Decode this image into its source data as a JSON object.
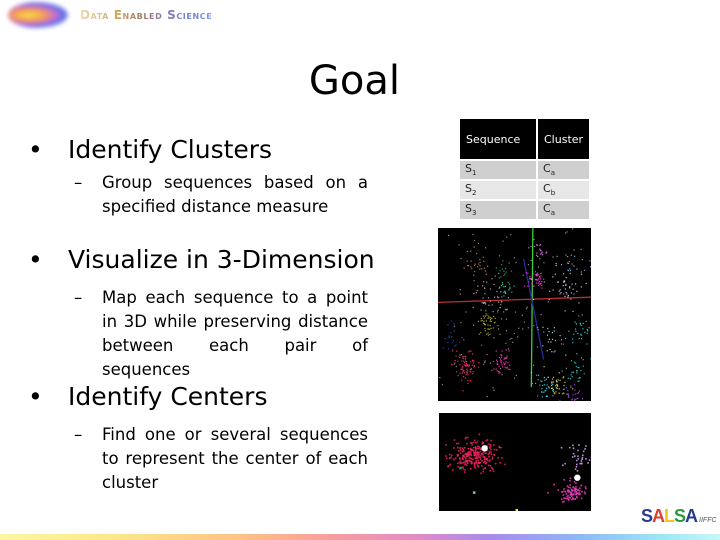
{
  "header": {
    "title": "Data Enabled Science",
    "logo_icon": "gradient-blob-icon"
  },
  "slide": {
    "title": "Goal",
    "bullets": [
      {
        "label": "Identify Clusters",
        "sub": "Group sequences based on a specified distance measure"
      },
      {
        "label": "Visualize in 3-Dimension",
        "sub": "Map each sequence to a point in 3D while preserving distance between each pair of sequences"
      },
      {
        "label": "Identify Centers",
        "sub": "Find one or several sequences to represent the center of each cluster"
      }
    ],
    "bullet_glyph": "•",
    "dash_glyph": "–"
  },
  "table": {
    "headers": [
      "Sequence",
      "Cluster"
    ],
    "rows": [
      {
        "seq": "S",
        "seq_sub": "1",
        "cluster": "C",
        "cluster_sub": "a"
      },
      {
        "seq": "S",
        "seq_sub": "2",
        "cluster": "C",
        "cluster_sub": "b"
      },
      {
        "seq": "S",
        "seq_sub": "3",
        "cluster": "C",
        "cluster_sub": "a"
      }
    ]
  },
  "plots": {
    "clusters_3d": {
      "description": "3D cluster visualization",
      "clusters": [
        {
          "color": "#c8875a",
          "cx": 0.25,
          "cy": 0.2,
          "n": 30,
          "spread": 0.05
        },
        {
          "color": "#d8a6c8",
          "cx": 0.35,
          "cy": 0.38,
          "n": 40,
          "spread": 0.06
        },
        {
          "color": "#2fd49a",
          "cx": 0.43,
          "cy": 0.35,
          "n": 18,
          "spread": 0.03
        },
        {
          "color": "#1fb27a",
          "cx": 0.43,
          "cy": 0.22,
          "n": 14,
          "spread": 0.03
        },
        {
          "color": "#ff2fd8",
          "cx": 0.63,
          "cy": 0.3,
          "n": 40,
          "spread": 0.03
        },
        {
          "color": "#e080e8",
          "cx": 0.67,
          "cy": 0.13,
          "n": 18,
          "spread": 0.03
        },
        {
          "color": "#e0c0f8",
          "cx": 0.83,
          "cy": 0.34,
          "n": 45,
          "spread": 0.06
        },
        {
          "color": "#7fb6d8",
          "cx": 0.85,
          "cy": 0.2,
          "n": 22,
          "spread": 0.05
        },
        {
          "color": "#b8b020",
          "cx": 0.33,
          "cy": 0.55,
          "n": 45,
          "spread": 0.035
        },
        {
          "color": "#2c4cb0",
          "cx": 0.1,
          "cy": 0.64,
          "n": 22,
          "spread": 0.04
        },
        {
          "color": "#ff2f6a",
          "cx": 0.18,
          "cy": 0.79,
          "n": 80,
          "spread": 0.045
        },
        {
          "color": "#ff3fb8",
          "cx": 0.41,
          "cy": 0.76,
          "n": 45,
          "spread": 0.035
        },
        {
          "color": "#ece268",
          "cx": 0.78,
          "cy": 0.9,
          "n": 40,
          "spread": 0.04
        },
        {
          "color": "#2fe0e8",
          "cx": 0.93,
          "cy": 0.6,
          "n": 24,
          "spread": 0.035
        },
        {
          "color": "#3fcfe0",
          "cx": 0.7,
          "cy": 0.92,
          "n": 30,
          "spread": 0.035
        },
        {
          "color": "#30d0d0",
          "cx": 0.9,
          "cy": 0.82,
          "n": 30,
          "spread": 0.04
        },
        {
          "color": "#b050e8",
          "cx": 0.87,
          "cy": 0.97,
          "n": 25,
          "spread": 0.03
        },
        {
          "color": "#a0e0f0",
          "cx": 0.73,
          "cy": 0.63,
          "n": 20,
          "spread": 0.05
        },
        {
          "color": "#ffffff",
          "cx": 0.5,
          "cy": 0.5,
          "n": 140,
          "spread": 0.35
        }
      ],
      "axes": [
        {
          "color": "#b83030",
          "x1": 0.0,
          "y1": 0.43,
          "x2": 1.0,
          "y2": 0.4
        },
        {
          "color": "#3ad03a",
          "x1": 0.62,
          "y1": 0.0,
          "x2": 0.61,
          "y2": 0.92
        },
        {
          "color": "#2a2a9a",
          "x1": 0.56,
          "y1": 0.18,
          "x2": 0.69,
          "y2": 0.76
        }
      ]
    },
    "centers": {
      "description": "Cluster centers visualization",
      "clusters": [
        {
          "color": "#e8205a",
          "cx": 0.22,
          "cy": 0.42,
          "n": 260,
          "spread": 0.08
        },
        {
          "color": "#e838b8",
          "cx": 0.88,
          "cy": 0.8,
          "n": 90,
          "spread": 0.045
        },
        {
          "color": "#c8a0e8",
          "cx": 0.93,
          "cy": 0.45,
          "n": 40,
          "spread": 0.06
        }
      ],
      "centers": [
        {
          "cx": 0.3,
          "cy": 0.36,
          "color": "#ffffff"
        },
        {
          "cx": 0.91,
          "cy": 0.66,
          "color": "#ffffff"
        }
      ],
      "strays": [
        {
          "cx": 0.51,
          "cy": 1.0,
          "color": "#f0e060"
        },
        {
          "cx": 0.23,
          "cy": 0.82,
          "color": "#60d0d0"
        },
        {
          "cx": 0.14,
          "cy": 0.57,
          "color": "#2a9a4a"
        }
      ]
    }
  },
  "footer": {
    "logo_parts": [
      "S",
      "A",
      "L",
      "S",
      "A"
    ],
    "logo_suffix": "IIFFC"
  }
}
